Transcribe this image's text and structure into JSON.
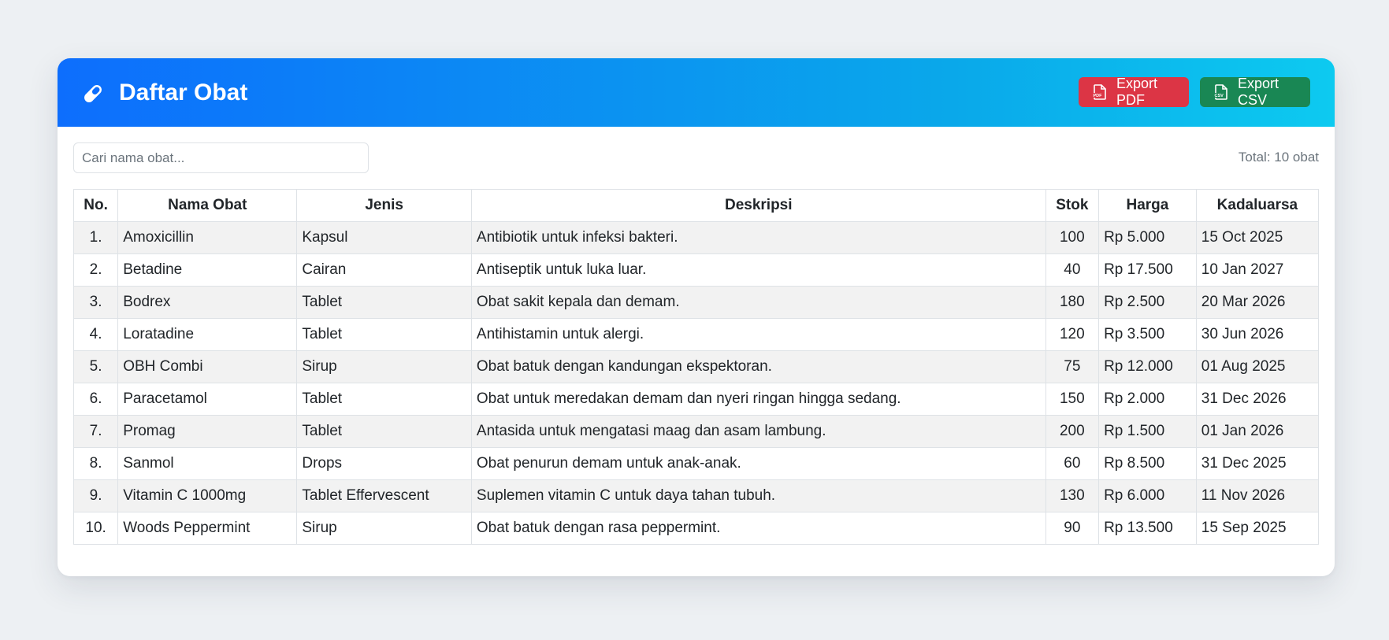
{
  "header": {
    "title": "Daftar Obat",
    "icon": "pill-icon",
    "export_pdf_label": "Export PDF",
    "export_csv_label": "Export CSV"
  },
  "search": {
    "placeholder": "Cari nama obat...",
    "value": ""
  },
  "total_label": "Total: 10 obat",
  "table": {
    "columns": [
      "No.",
      "Nama Obat",
      "Jenis",
      "Deskripsi",
      "Stok",
      "Harga",
      "Kadaluarsa"
    ],
    "rows": [
      {
        "no": "1.",
        "nama": "Amoxicillin",
        "jenis": "Kapsul",
        "deskripsi": "Antibiotik untuk infeksi bakteri.",
        "stok": "100",
        "harga": "Rp 5.000",
        "kadaluarsa": "15 Oct 2025"
      },
      {
        "no": "2.",
        "nama": "Betadine",
        "jenis": "Cairan",
        "deskripsi": "Antiseptik untuk luka luar.",
        "stok": "40",
        "harga": "Rp 17.500",
        "kadaluarsa": "10 Jan 2027"
      },
      {
        "no": "3.",
        "nama": "Bodrex",
        "jenis": "Tablet",
        "deskripsi": "Obat sakit kepala dan demam.",
        "stok": "180",
        "harga": "Rp 2.500",
        "kadaluarsa": "20 Mar 2026"
      },
      {
        "no": "4.",
        "nama": "Loratadine",
        "jenis": "Tablet",
        "deskripsi": "Antihistamin untuk alergi.",
        "stok": "120",
        "harga": "Rp 3.500",
        "kadaluarsa": "30 Jun 2026"
      },
      {
        "no": "5.",
        "nama": "OBH Combi",
        "jenis": "Sirup",
        "deskripsi": "Obat batuk dengan kandungan ekspektoran.",
        "stok": "75",
        "harga": "Rp 12.000",
        "kadaluarsa": "01 Aug 2025"
      },
      {
        "no": "6.",
        "nama": "Paracetamol",
        "jenis": "Tablet",
        "deskripsi": "Obat untuk meredakan demam dan nyeri ringan hingga sedang.",
        "stok": "150",
        "harga": "Rp 2.000",
        "kadaluarsa": "31 Dec 2026"
      },
      {
        "no": "7.",
        "nama": "Promag",
        "jenis": "Tablet",
        "deskripsi": "Antasida untuk mengatasi maag dan asam lambung.",
        "stok": "200",
        "harga": "Rp 1.500",
        "kadaluarsa": "01 Jan 2026"
      },
      {
        "no": "8.",
        "nama": "Sanmol",
        "jenis": "Drops",
        "deskripsi": "Obat penurun demam untuk anak-anak.",
        "stok": "60",
        "harga": "Rp 8.500",
        "kadaluarsa": "31 Dec 2025"
      },
      {
        "no": "9.",
        "nama": "Vitamin C 1000mg",
        "jenis": "Tablet Effervescent",
        "deskripsi": "Suplemen vitamin C untuk daya tahan tubuh.",
        "stok": "130",
        "harga": "Rp 6.000",
        "kadaluarsa": "11 Nov 2026"
      },
      {
        "no": "10.",
        "nama": "Woods Peppermint",
        "jenis": "Sirup",
        "deskripsi": "Obat batuk dengan rasa peppermint.",
        "stok": "90",
        "harga": "Rp 13.500",
        "kadaluarsa": "15 Sep 2025"
      }
    ]
  },
  "colors": {
    "header_gradient_start": "#0d6efd",
    "header_gradient_end": "#0dcaf0",
    "export_pdf_bg": "#dc3545",
    "export_csv_bg": "#198754"
  }
}
